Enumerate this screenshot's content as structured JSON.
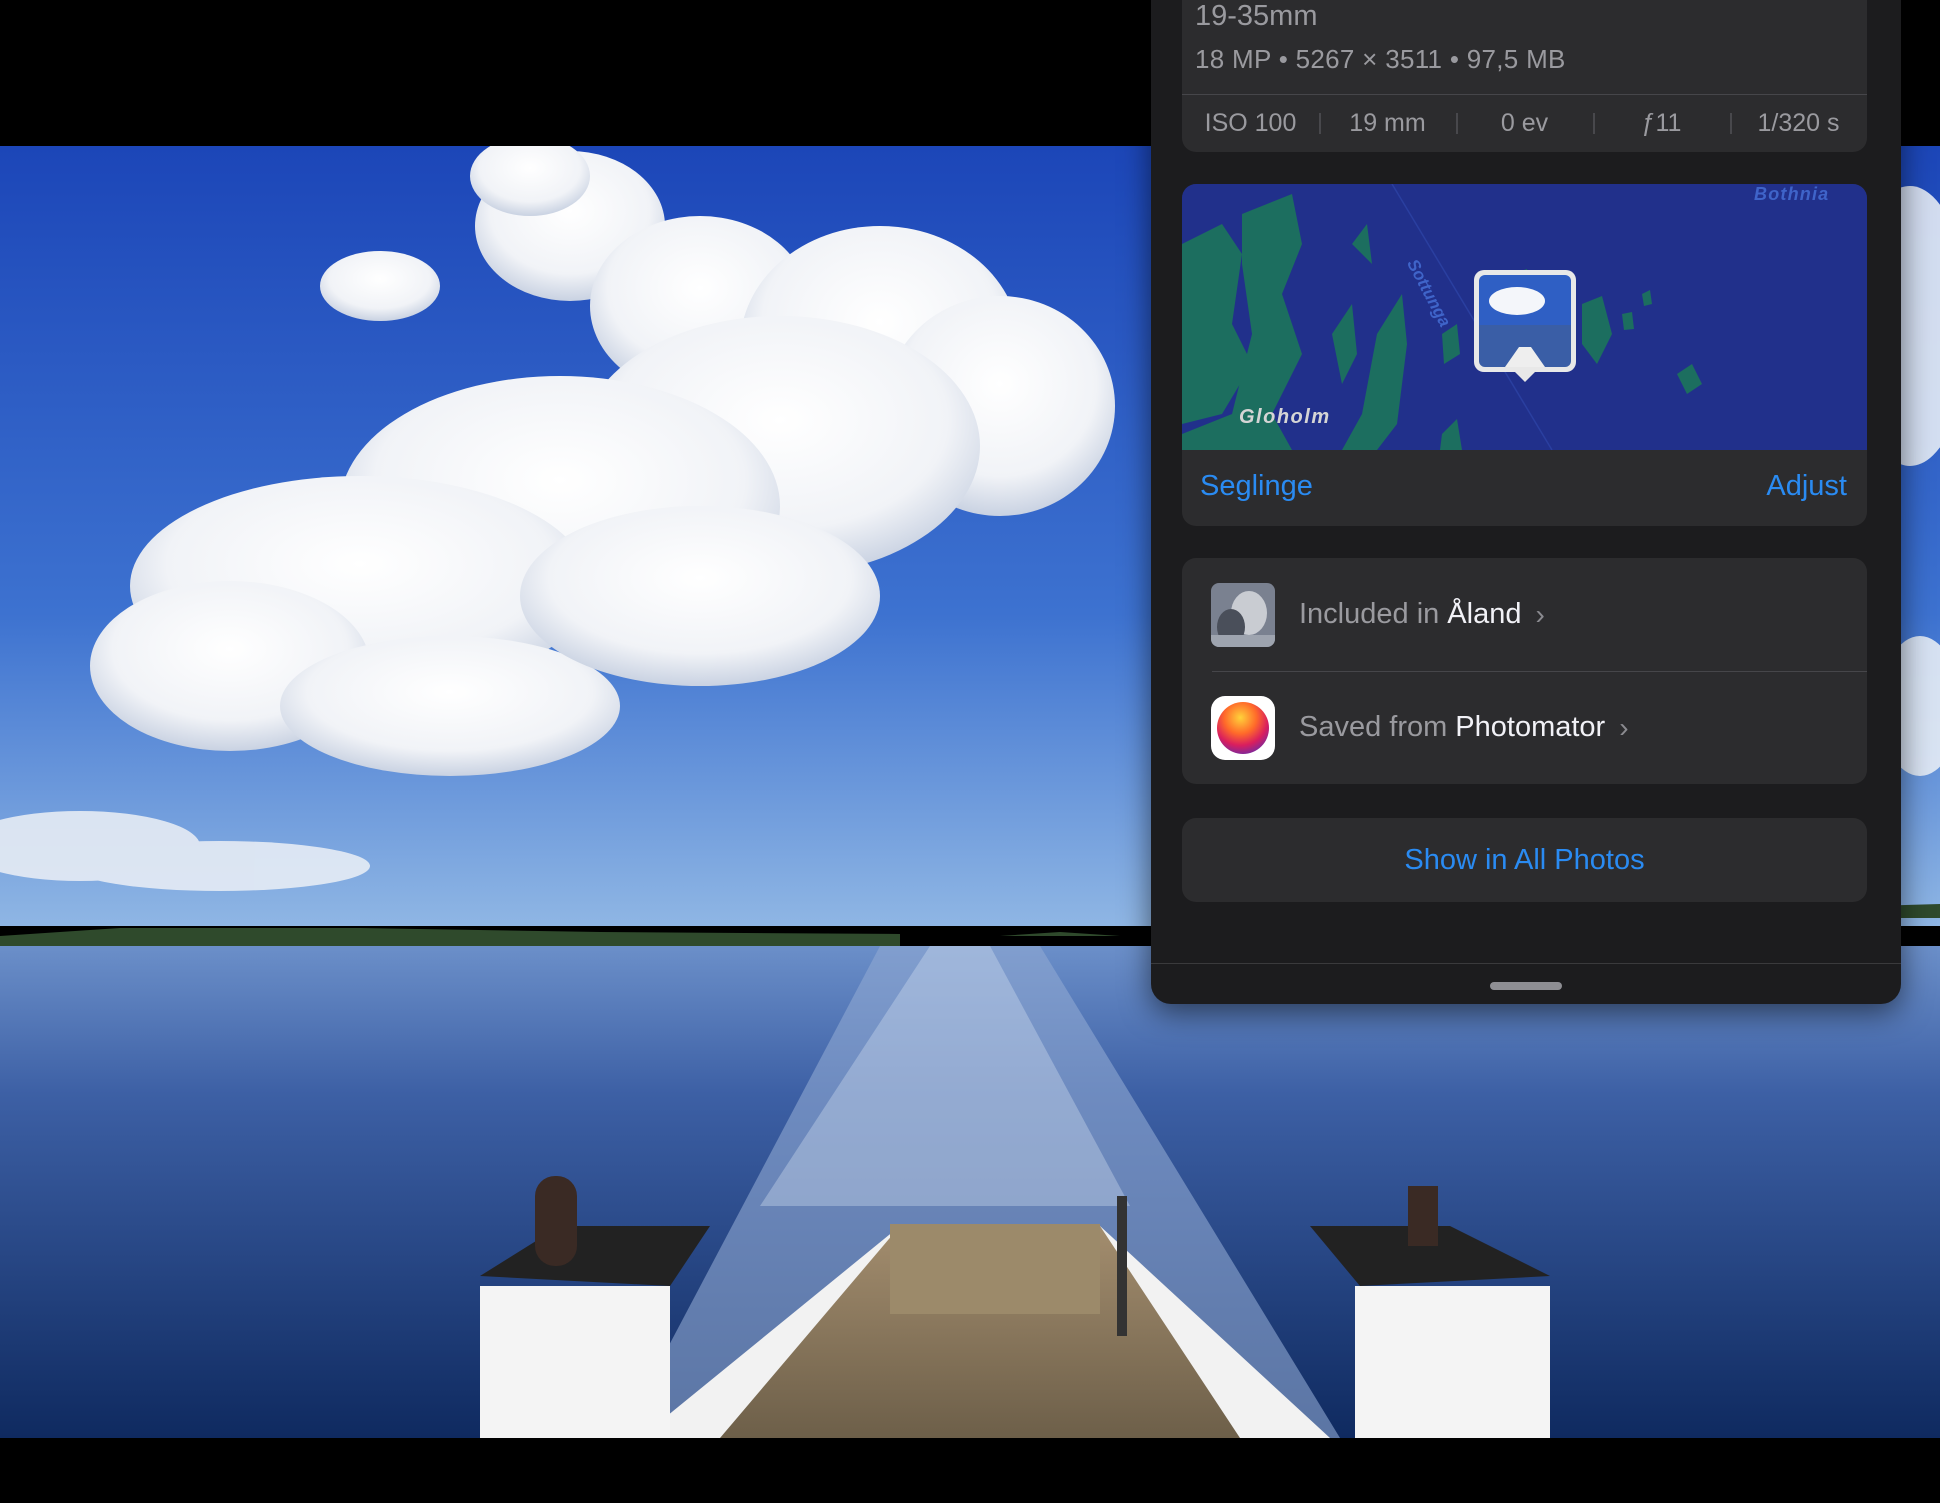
{
  "photo": {
    "icon": "ferry-wake-photo"
  },
  "info_panel": {
    "camera": {
      "lens": "19-35mm",
      "specs": "18 MP • 5267 × 3511 • 97,5 MB",
      "exif": [
        "ISO 100",
        "19 mm",
        "0 ev",
        "ƒ11",
        "1/320 s"
      ]
    },
    "map": {
      "labels": {
        "gloholm": "Gloholm",
        "bothnia": "Bothnia",
        "sottunga": "Sottunga"
      },
      "location_name": "Seglinge",
      "adjust_label": "Adjust",
      "colors": {
        "water": "#21308b",
        "land": "#1c6e5f"
      }
    },
    "album_row": {
      "prefix": "Included in",
      "name": "Åland",
      "icon": "album-thumbnail",
      "chevron": "chevron-right-icon"
    },
    "saved_row": {
      "prefix": "Saved from",
      "name": "Photomator",
      "icon": "photomator-app-icon",
      "chevron": "chevron-right-icon"
    },
    "show_button": "Show in All Photos",
    "accent": "#2a8bf2"
  }
}
